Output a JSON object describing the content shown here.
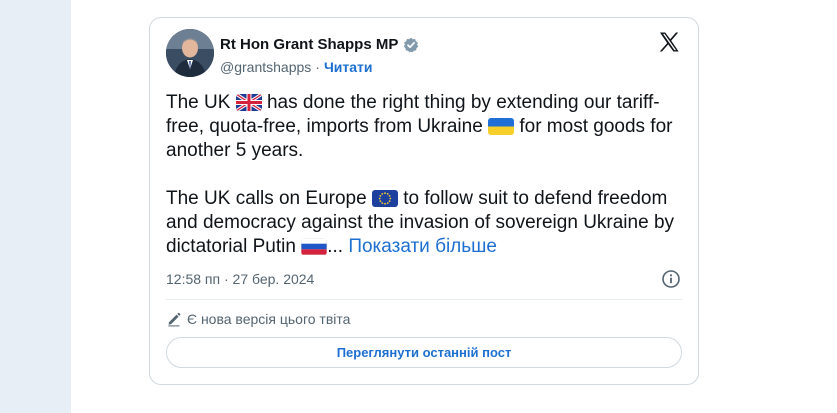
{
  "tweet": {
    "author_name": "Rt Hon Grant Shapps MP",
    "handle": "@grantshapps",
    "separator": "·",
    "follow_label": "Читати",
    "text": {
      "line1_a": "The UK",
      "line1_b": "has done the right thing by extending our tariff-free, quota-free, imports from Ukraine",
      "line1_c": "for most goods for another 5 years.",
      "line2_a": "The UK calls on Europe",
      "line2_b": "to follow suit to defend freedom and democracy against the invasion of sovereign Ukraine by dictatorial Putin",
      "ellipsis": "...",
      "show_more": "Показати більше"
    },
    "timestamp": "12:58 пп · 27 бер. 2024",
    "edited_notice": "Є нова версія цього твіта",
    "view_latest_label": "Переглянути останній пост"
  },
  "icons": {
    "verified": "verified-badge-icon",
    "x_logo": "x-logo-icon",
    "info": "info-icon",
    "pencil": "pencil-icon",
    "flags": [
      "uk-flag-icon",
      "ukraine-flag-icon",
      "eu-flag-icon",
      "russia-flag-icon"
    ]
  },
  "colors": {
    "link": "#1d6fd1",
    "muted": "#536471",
    "border": "#cfd9de",
    "left_rail": "#e8eef5"
  }
}
